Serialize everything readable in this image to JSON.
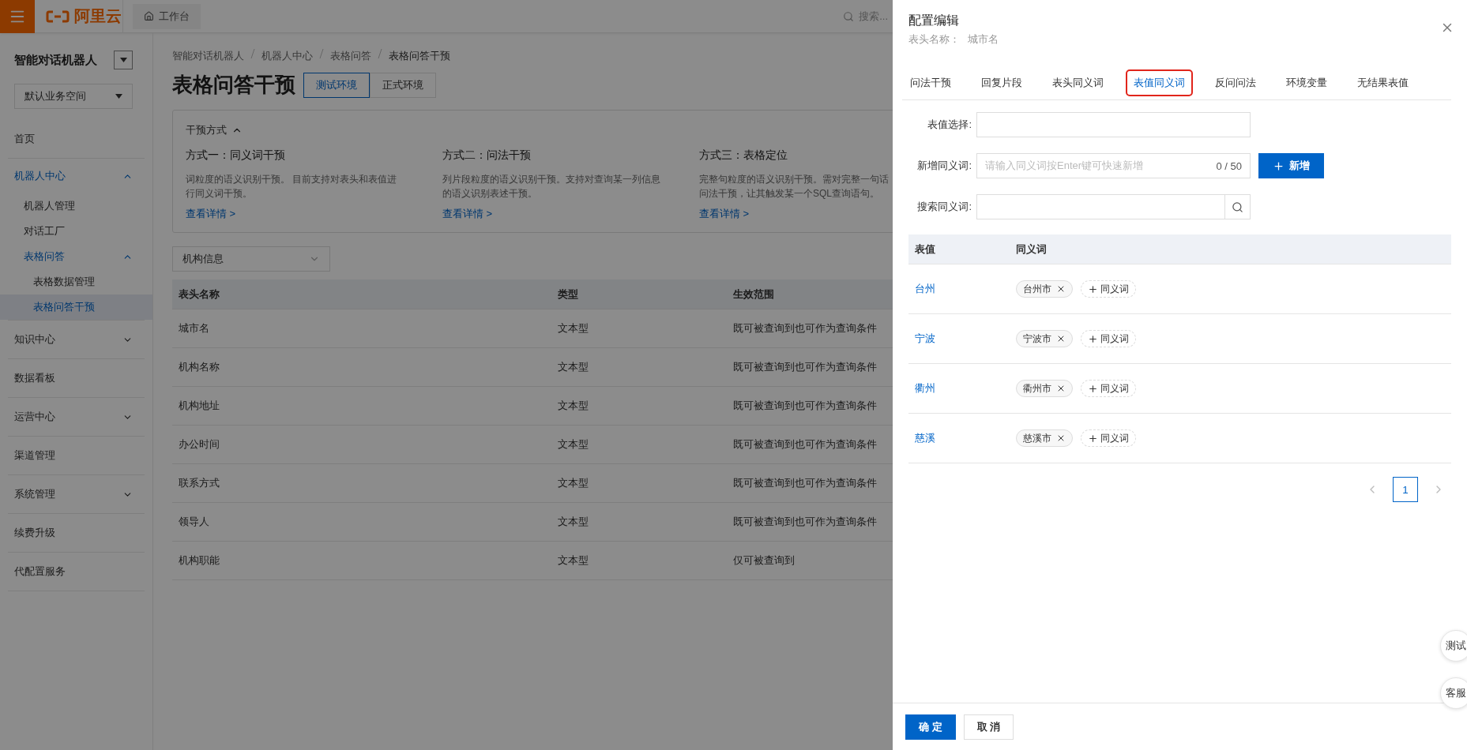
{
  "topbar": {
    "brand": "阿里云",
    "workbench": "工作台",
    "search_placeholder": "搜索..."
  },
  "sidebar": {
    "title": "智能对话机器人",
    "workspace": "默认业务空间",
    "items": [
      {
        "label": "首页",
        "selected": false
      },
      {
        "label": "机器人中心",
        "selected": false,
        "expanded": true,
        "children": [
          {
            "label": "机器人管理",
            "selected": false
          },
          {
            "label": "对话工厂",
            "selected": false
          },
          {
            "label": "表格问答",
            "selected": false,
            "expanded": true,
            "children": [
              {
                "label": "表格数据管理",
                "selected": false
              },
              {
                "label": "表格问答干预",
                "selected": true
              }
            ]
          }
        ]
      },
      {
        "label": "知识中心",
        "selected": false,
        "expanded": false
      },
      {
        "label": "数据看板",
        "selected": false
      },
      {
        "label": "运营中心",
        "selected": false,
        "expanded": false
      },
      {
        "label": "渠道管理",
        "selected": false
      },
      {
        "label": "系统管理",
        "selected": false,
        "expanded": false
      },
      {
        "label": "续费升级",
        "selected": false
      },
      {
        "label": "代配置服务",
        "selected": false
      }
    ]
  },
  "breadcrumb": [
    "智能对话机器人",
    "机器人中心",
    "表格问答",
    "表格问答干预"
  ],
  "page_title": "表格问答干预",
  "env_tabs": [
    {
      "label": "测试环境",
      "selected": true
    },
    {
      "label": "正式环境",
      "selected": false
    }
  ],
  "methods": {
    "title": "干预方式",
    "expanded": true,
    "items": [
      {
        "title": "方式一：同义词干预",
        "lines": [
          "词粒度的语义识别干预。 目前支持对表头和表值进",
          "行同义词干预。"
        ],
        "link": "查看详情 >"
      },
      {
        "title": "方式二：问法干预",
        "lines": [
          "列片段粒度的语义识别干预。支持对查询某一列信息",
          "的语义识别表述干预。"
        ],
        "link": "查看详情 >"
      },
      {
        "title": "方式三：表格定位",
        "lines": [
          "完整句粒度的语义识别干预。需对完整一句话",
          "问法干预，让其触发某一个SQL查询语句。"
        ],
        "link": "查看详情 >"
      }
    ]
  },
  "table_select": "机构信息",
  "table": {
    "columns": [
      "表头名称",
      "类型",
      "生效范围"
    ],
    "rows": [
      [
        "城市名",
        "文本型",
        "既可被查询到也可作为查询条件"
      ],
      [
        "机构名称",
        "文本型",
        "既可被查询到也可作为查询条件"
      ],
      [
        "机构地址",
        "文本型",
        "既可被查询到也可作为查询条件"
      ],
      [
        "办公时间",
        "文本型",
        "既可被查询到也可作为查询条件"
      ],
      [
        "联系方式",
        "文本型",
        "既可被查询到也可作为查询条件"
      ],
      [
        "领导人",
        "文本型",
        "既可被查询到也可作为查询条件"
      ],
      [
        "机构职能",
        "文本型",
        "仅可被查询到"
      ]
    ]
  },
  "drawer": {
    "title": "配置编辑",
    "subtitle_label": "表头名称：",
    "subtitle_value": "城市名",
    "tabs": [
      {
        "label": "问法干预",
        "selected": false,
        "highlighted": false
      },
      {
        "label": "回复片段",
        "selected": false,
        "highlighted": false
      },
      {
        "label": "表头同义词",
        "selected": false,
        "highlighted": false
      },
      {
        "label": "表值同义词",
        "selected": true,
        "highlighted": true
      },
      {
        "label": "反问问法",
        "selected": false,
        "highlighted": false
      },
      {
        "label": "环境变量",
        "selected": false,
        "highlighted": false
      },
      {
        "label": "无结果表值",
        "selected": false,
        "highlighted": false
      }
    ],
    "value_select_label": "表值选择:",
    "add_label": "新增同义词:",
    "add_placeholder": "请输入同义词按Enter键可快速新增",
    "add_count": "0 / 50",
    "add_button": "新增",
    "search_label": "搜索同义词:",
    "synonym_table": {
      "columns": [
        "表值",
        "同义词"
      ],
      "rows": [
        {
          "value": "台州",
          "synonyms": [
            "台州市"
          ],
          "add": "同义词"
        },
        {
          "value": "宁波",
          "synonyms": [
            "宁波市"
          ],
          "add": "同义词"
        },
        {
          "value": "衢州",
          "synonyms": [
            "衢州市"
          ],
          "add": "同义词"
        },
        {
          "value": "慈溪",
          "synonyms": [
            "慈溪市"
          ],
          "add": "同义词"
        }
      ]
    },
    "pages": [
      {
        "label": "1",
        "selected": true
      }
    ],
    "float_buttons": [
      "测试",
      "客服"
    ],
    "ok": "确 定",
    "cancel": "取 消"
  }
}
